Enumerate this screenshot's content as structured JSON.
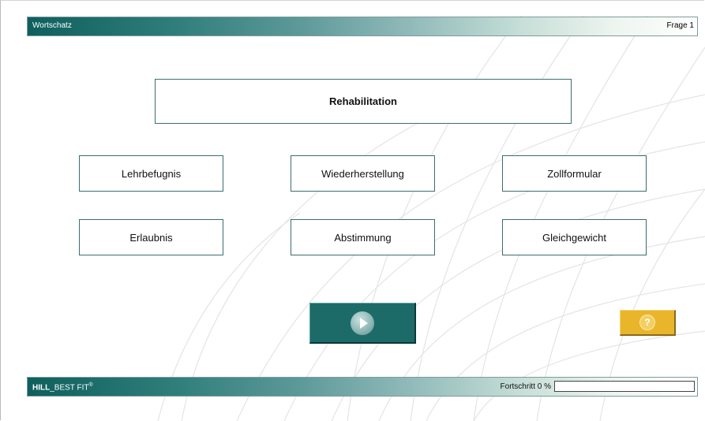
{
  "header": {
    "title": "Wortschatz",
    "question": "Frage 1"
  },
  "prompt": {
    "word": "Rehabilitation"
  },
  "options": [
    {
      "label": "Lehrbefugnis"
    },
    {
      "label": "Wiederherstellung"
    },
    {
      "label": "Zollformular"
    },
    {
      "label": "Erlaubnis"
    },
    {
      "label": "Abstimmung"
    },
    {
      "label": "Gleichgewicht"
    }
  ],
  "controls": {
    "play_icon": "play-icon",
    "help_icon": "help-icon",
    "help_symbol": "?"
  },
  "footer": {
    "brand_bold": "HILL",
    "brand_rest": "_BEST FIT",
    "brand_mark": "®",
    "progress_label": "Fortschritt 0 %",
    "progress_value": 0
  },
  "colors": {
    "accent": "#0e5f5d",
    "button": "#1c6b68",
    "help": "#e9b52a"
  }
}
